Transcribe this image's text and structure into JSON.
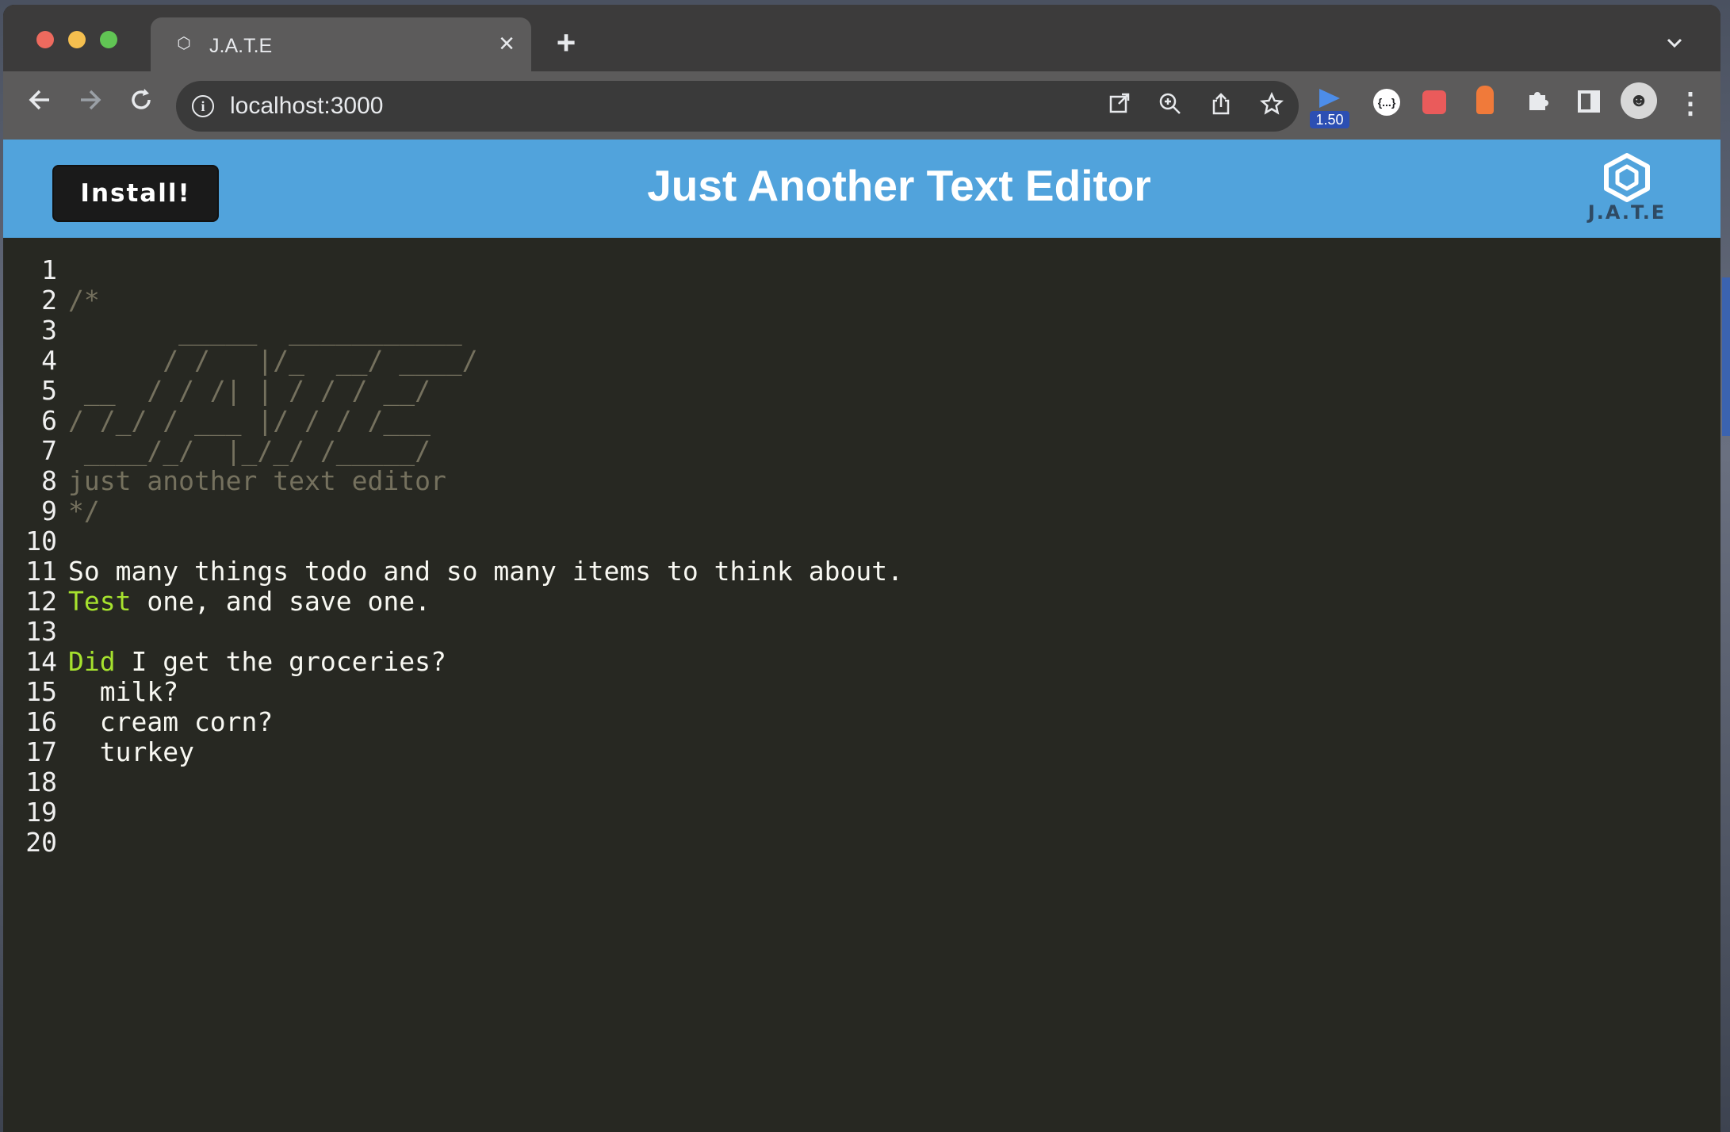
{
  "browser": {
    "tab_title": "J.A.T.E",
    "url": "localhost:3000",
    "extension_badge": "1.50"
  },
  "icons": {
    "tab_favicon": "jate-logo-icon",
    "tab_close": "close-icon",
    "new_tab": "plus-icon",
    "tab_list": "chevron-down-icon",
    "back": "arrow-left-icon",
    "forward": "arrow-right-icon",
    "reload": "reload-icon",
    "site_info": "info-icon",
    "install_app": "open-external-icon",
    "zoom": "zoom-icon",
    "share": "share-icon",
    "bookmark": "star-icon",
    "extensions": "puzzle-icon",
    "sidebar": "sidebar-icon",
    "profile": "avatar-icon",
    "menu": "more-vert-icon"
  },
  "app": {
    "install_label": "Install!",
    "heading": "Just Another Text Editor",
    "logo_text": "J.A.T.E"
  },
  "colors": {
    "navbar": "#51a3dc",
    "editor_bg": "#272822",
    "comment": "#75715e",
    "keyword": "#a6e22e",
    "text": "#f8f8f2"
  },
  "editor": {
    "lines": [
      {
        "num": "1",
        "text": "",
        "type": "plain"
      },
      {
        "num": "2",
        "text": "/*",
        "type": "comment"
      },
      {
        "num": "3",
        "text": "       _____  ___________",
        "type": "comment"
      },
      {
        "num": "4",
        "text": "      / /   |/_  __/ ____/",
        "type": "comment"
      },
      {
        "num": "5",
        "text": " __  / / /| | / / / __/",
        "type": "comment"
      },
      {
        "num": "6",
        "text": "/ /_/ / ___ |/ / / /___",
        "type": "comment"
      },
      {
        "num": "7",
        "text": " ____/_/  |_/_/ /_____/",
        "type": "comment"
      },
      {
        "num": "8",
        "text": "just another text editor",
        "type": "comment"
      },
      {
        "num": "9",
        "text": "*/",
        "type": "comment"
      },
      {
        "num": "10",
        "text": "",
        "type": "plain"
      },
      {
        "num": "11",
        "text": "So many things todo and so many items to think about.",
        "type": "plain"
      },
      {
        "num": "12",
        "kw": "Test",
        "rest": " one, and save one.",
        "type": "keyword"
      },
      {
        "num": "13",
        "text": "",
        "type": "plain"
      },
      {
        "num": "14",
        "kw": "Did",
        "rest": " I get the groceries?",
        "type": "keyword"
      },
      {
        "num": "15",
        "text": "  milk?",
        "type": "plain"
      },
      {
        "num": "16",
        "text": "  cream corn?",
        "type": "plain"
      },
      {
        "num": "17",
        "text": "  turkey",
        "type": "plain"
      },
      {
        "num": "18",
        "text": "",
        "type": "plain"
      },
      {
        "num": "19",
        "text": "",
        "type": "plain"
      },
      {
        "num": "20",
        "text": "",
        "type": "plain"
      }
    ]
  }
}
